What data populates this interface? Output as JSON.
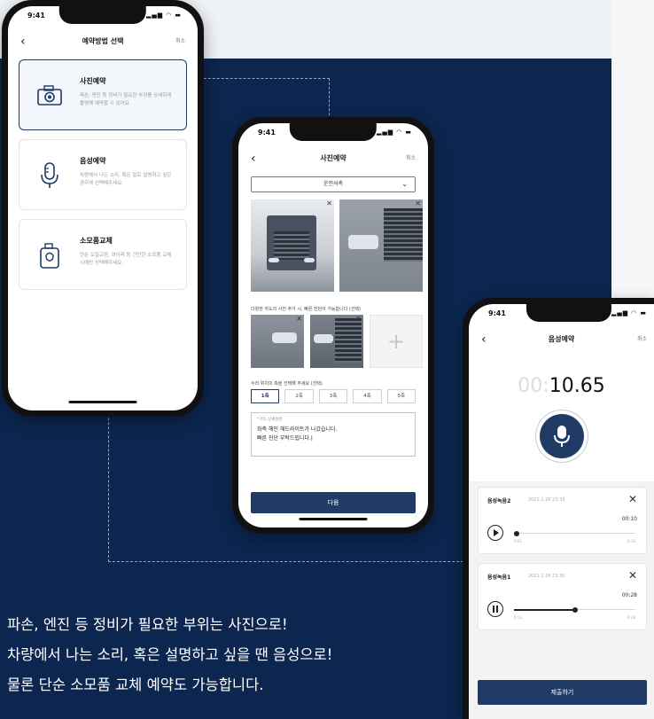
{
  "colors": {
    "navy": "#0c2650",
    "accent": "#e33a78",
    "button": "#1f3b66"
  },
  "phone1": {
    "time": "9:41",
    "title": "예약방법 선택",
    "cancel": "취소",
    "options": [
      {
        "title": "사진예약",
        "desc": "파손, 엔진 등 정비가 필요한 부위를 상세하게 촬영해 예약할 수 있어요.",
        "icon": "camera-icon"
      },
      {
        "title": "음성예약",
        "desc": "차량에서 나는 소리, 혹은 말로 설명하고 싶은 경우에 선택해주세요.",
        "icon": "microphone-icon"
      },
      {
        "title": "소모품교체",
        "desc": "단순 오일교환, 와이퍼 등 간단한 소모품 교체시에만 선택해주세요.",
        "icon": "oil-can-icon"
      }
    ]
  },
  "phone2": {
    "time": "9:41",
    "title": "사진예약",
    "cancel": "취소",
    "dropdown_value": "운전석측",
    "photo_caption": "다양한 각도의 사진 추가 시, 빠른 진단이 가능합니다 (선택)",
    "rating_caption": "수리 위치의 측을 선택해 주세요 (선택)",
    "options": [
      "1축",
      "2축",
      "3축",
      "4축",
      "5축"
    ],
    "memo_label": "*기타 상세설명",
    "memo_text": "좌측 헤인 헤드라이트가 나갔습니다.\n빠른 진단 부탁드립니다.|",
    "next_label": "다음"
  },
  "phone3": {
    "time": "9:41",
    "title": "음성예약",
    "cancel": "취소",
    "timer_dim": "00:",
    "timer_value": "10.65",
    "recordings": [
      {
        "name": "음성녹음2",
        "date": "2021.1.26 23:33",
        "total": "00:10",
        "start": "0:01",
        "end": "-0:10",
        "progress": 0.02,
        "state": "paused"
      },
      {
        "name": "음성녹음1",
        "date": "2021.1.26 23:30",
        "total": "00:28",
        "start": "0:13",
        "end": "-0:28",
        "progress": 0.5,
        "state": "playing"
      }
    ],
    "submit_label": "제출하기"
  },
  "captions": [
    "파손, 엔진 등 정비가 필요한 부위는 사진으로!",
    "차량에서 나는 소리, 혹은 설명하고 싶을 땐 음성으로!",
    "물론 단순 소모품 교체 예약도 가능합니다."
  ]
}
